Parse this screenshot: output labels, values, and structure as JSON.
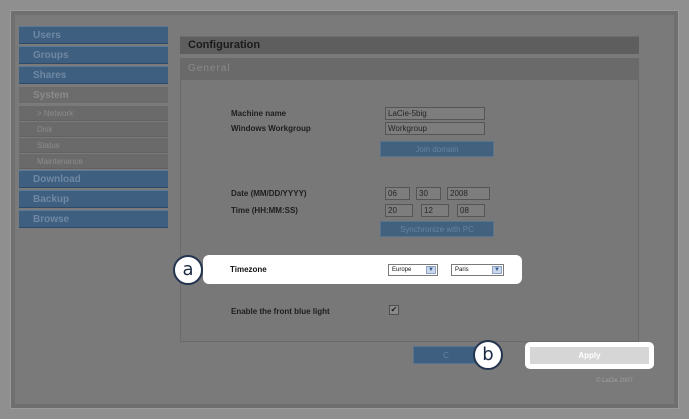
{
  "sidebar": {
    "items": [
      {
        "label": "Users"
      },
      {
        "label": "Groups"
      },
      {
        "label": "Shares"
      },
      {
        "label": "System"
      },
      {
        "label": "> Network"
      },
      {
        "label": "Disk"
      },
      {
        "label": "Status"
      },
      {
        "label": "Maintenance"
      },
      {
        "label": "Download"
      },
      {
        "label": "Backup"
      },
      {
        "label": "Browse"
      }
    ]
  },
  "main": {
    "section_title": "Configuration",
    "subsection_title": "General",
    "machine_name_label": "Machine name",
    "machine_name_value": "LaCie-5big",
    "workgroup_label": "Windows Workgroup",
    "workgroup_value": "Workgroup",
    "join_domain_label": "Join domain",
    "date_label": "Date (MM/DD/YYYY)",
    "date_month": "06",
    "date_day": "30",
    "date_year": "2008",
    "time_label": "Time (HH:MM:SS)",
    "time_hh": "20",
    "time_mm": "12",
    "time_ss": "08",
    "sync_label": "Synchronize with PC",
    "timezone_label": "Timezone",
    "timezone_region": "Europe",
    "timezone_city": "Paris",
    "front_light_label": "Enable the front blue light",
    "front_light_checked": true,
    "cancel_label": "C",
    "apply_label": "Apply",
    "copyright": "© LaCie 2007"
  },
  "callouts": {
    "a": "a",
    "b": "b"
  }
}
